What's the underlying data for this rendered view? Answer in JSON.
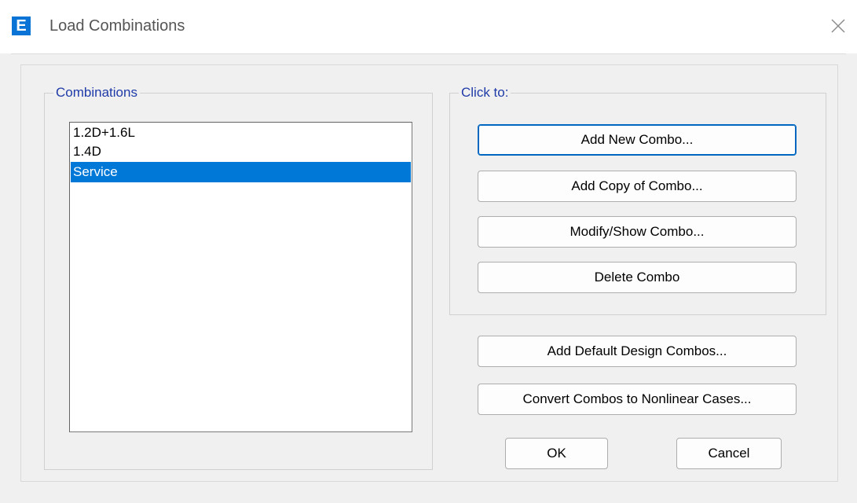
{
  "window": {
    "title": "Load Combinations",
    "app_icon_letter": "E"
  },
  "combinations": {
    "label": "Combinations",
    "items": [
      {
        "label": "1.2D+1.6L",
        "selected": false
      },
      {
        "label": "1.4D",
        "selected": false
      },
      {
        "label": "Service",
        "selected": true
      }
    ]
  },
  "click_to": {
    "label": "Click to:",
    "add_new": "Add New Combo...",
    "add_copy": "Add Copy of Combo...",
    "modify_show": "Modify/Show Combo...",
    "delete": "Delete Combo"
  },
  "extra": {
    "add_default": "Add Default Design Combos...",
    "convert": "Convert Combos to Nonlinear Cases..."
  },
  "footer": {
    "ok": "OK",
    "cancel": "Cancel"
  },
  "colors": {
    "accent": "#0078d7",
    "legend_text": "#1f3ba8",
    "app_icon": "#0a74d6"
  }
}
